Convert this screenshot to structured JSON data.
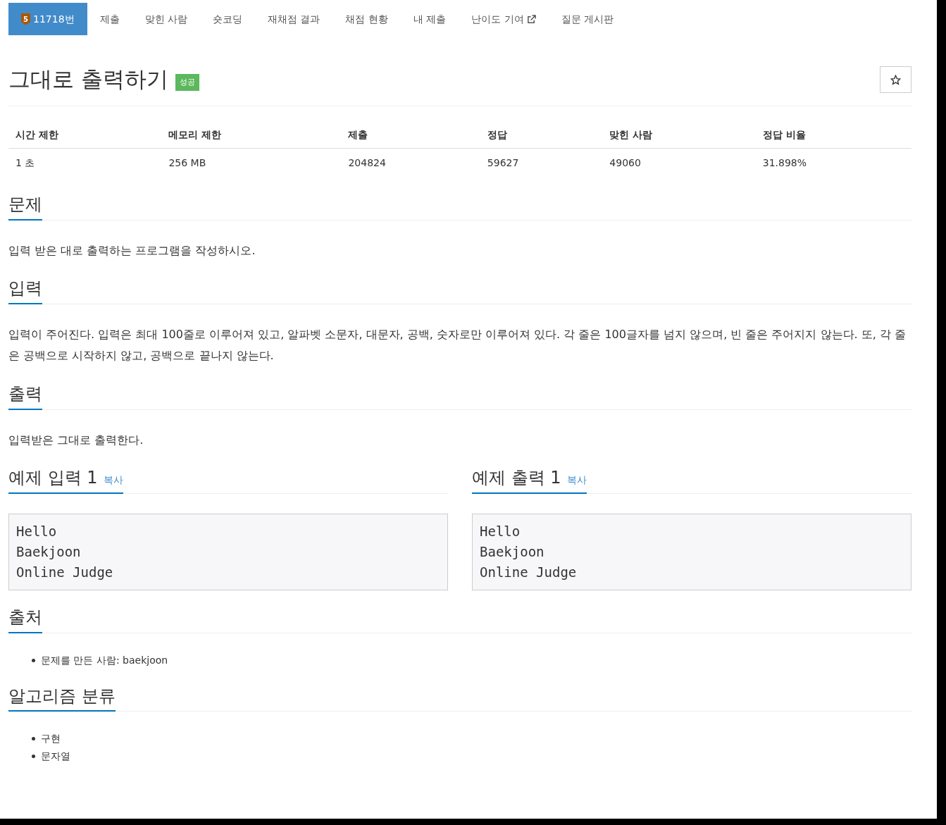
{
  "nav": {
    "tier": "5",
    "items": [
      {
        "label": "11718번",
        "selected": true,
        "kind": "problem"
      },
      {
        "label": "제출",
        "selected": false,
        "kind": "plain"
      },
      {
        "label": "맞힌 사람",
        "selected": false,
        "kind": "plain"
      },
      {
        "label": "숏코딩",
        "selected": false,
        "kind": "plain"
      },
      {
        "label": "재채점 결과",
        "selected": false,
        "kind": "plain"
      },
      {
        "label": "채점 현황",
        "selected": false,
        "kind": "plain"
      },
      {
        "label": "내 제출",
        "selected": false,
        "kind": "plain"
      },
      {
        "label": "난이도 기여",
        "selected": false,
        "kind": "external"
      },
      {
        "label": "질문 게시판",
        "selected": false,
        "kind": "plain"
      }
    ]
  },
  "title": "그대로 출력하기",
  "status_badge": "성공",
  "starred": false,
  "info_table": {
    "columns": [
      "시간 제한",
      "메모리 제한",
      "제출",
      "정답",
      "맞힌 사람",
      "정답 비율"
    ],
    "rows": [
      [
        "1 초",
        "256 MB",
        "204824",
        "59627",
        "49060",
        "31.898%"
      ]
    ]
  },
  "sections": [
    {
      "heading": "문제",
      "body": "입력 받은 대로 출력하는 프로그램을 작성하시오."
    },
    {
      "heading": "입력",
      "body": "입력이 주어진다. 입력은 최대 100줄로 이루어져 있고, 알파벳 소문자, 대문자, 공백, 숫자로만 이루어져 있다. 각 줄은 100글자를 넘지 않으며, 빈 줄은 주어지지 않는다. 또, 각 줄은 공백으로 시작하지 않고, 공백으로 끝나지 않는다."
    },
    {
      "heading": "출력",
      "body": "입력받은 그대로 출력한다."
    }
  ],
  "samples": [
    {
      "heading": "예제 입력 1",
      "copy": "복사",
      "lines": [
        "Hello",
        "Baekjoon",
        "Online Judge"
      ]
    },
    {
      "heading": "예제 출력 1",
      "copy": "복사",
      "lines": [
        "Hello",
        "Baekjoon",
        "Online Judge"
      ]
    }
  ],
  "source": {
    "heading": "출처",
    "items": [
      "문제를 만든 사람: baekjoon"
    ]
  },
  "tags": {
    "heading": "알고리즘 분류",
    "items": [
      "구현",
      "문자열"
    ]
  }
}
